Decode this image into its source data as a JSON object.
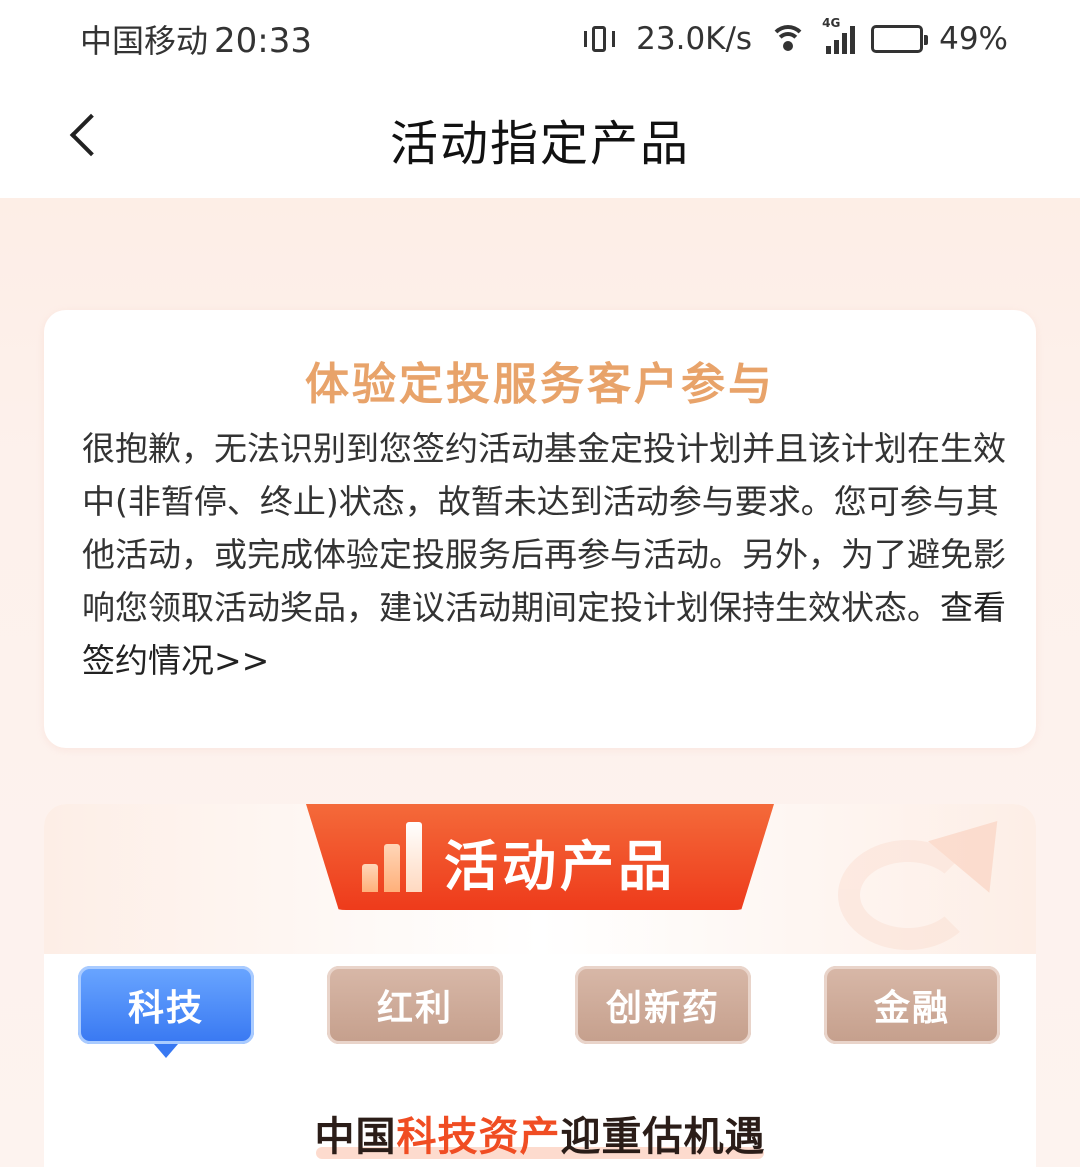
{
  "status_bar": {
    "carrier": "中国移动",
    "time": "20:33",
    "net_speed": "23.0K/s",
    "network_type": "4G",
    "battery_percent": "49%",
    "battery_level": 0.49,
    "icons": [
      "vibrate-icon",
      "wifi-icon",
      "signal-icon",
      "battery-icon"
    ]
  },
  "nav": {
    "title": "活动指定产品",
    "back_icon": "chevron-left-icon"
  },
  "notice": {
    "title": "体验定投服务客户参与",
    "body": "很抱歉，无法识别到您签约活动基金定投计划并且该计划在生效中(非暂停、终止)状态，故暂未达到活动参与要求。您可参与其他活动，或完成体验定投服务后再参与活动。另外，为了避免影响您领取活动奖品，建议活动期间定投计划保持生效状态。",
    "link": "查看签约情况>>"
  },
  "products": {
    "banner_title": "活动产品",
    "banner_icon": "bar-chart-icon",
    "tabs": [
      {
        "label": "科技",
        "active": true
      },
      {
        "label": "红利",
        "active": false
      },
      {
        "label": "创新药",
        "active": false
      },
      {
        "label": "金融",
        "active": false
      }
    ],
    "subheading": {
      "prefix": "中国",
      "highlight": "科技资产",
      "suffix": "迎重估机遇"
    }
  },
  "colors": {
    "accent_orange": "#ee3b1b",
    "title_gold": "#e8a36a",
    "tab_active_blue": "#3878f2",
    "tab_inactive": "#c59f8c",
    "highlight_red": "#f04d23"
  }
}
